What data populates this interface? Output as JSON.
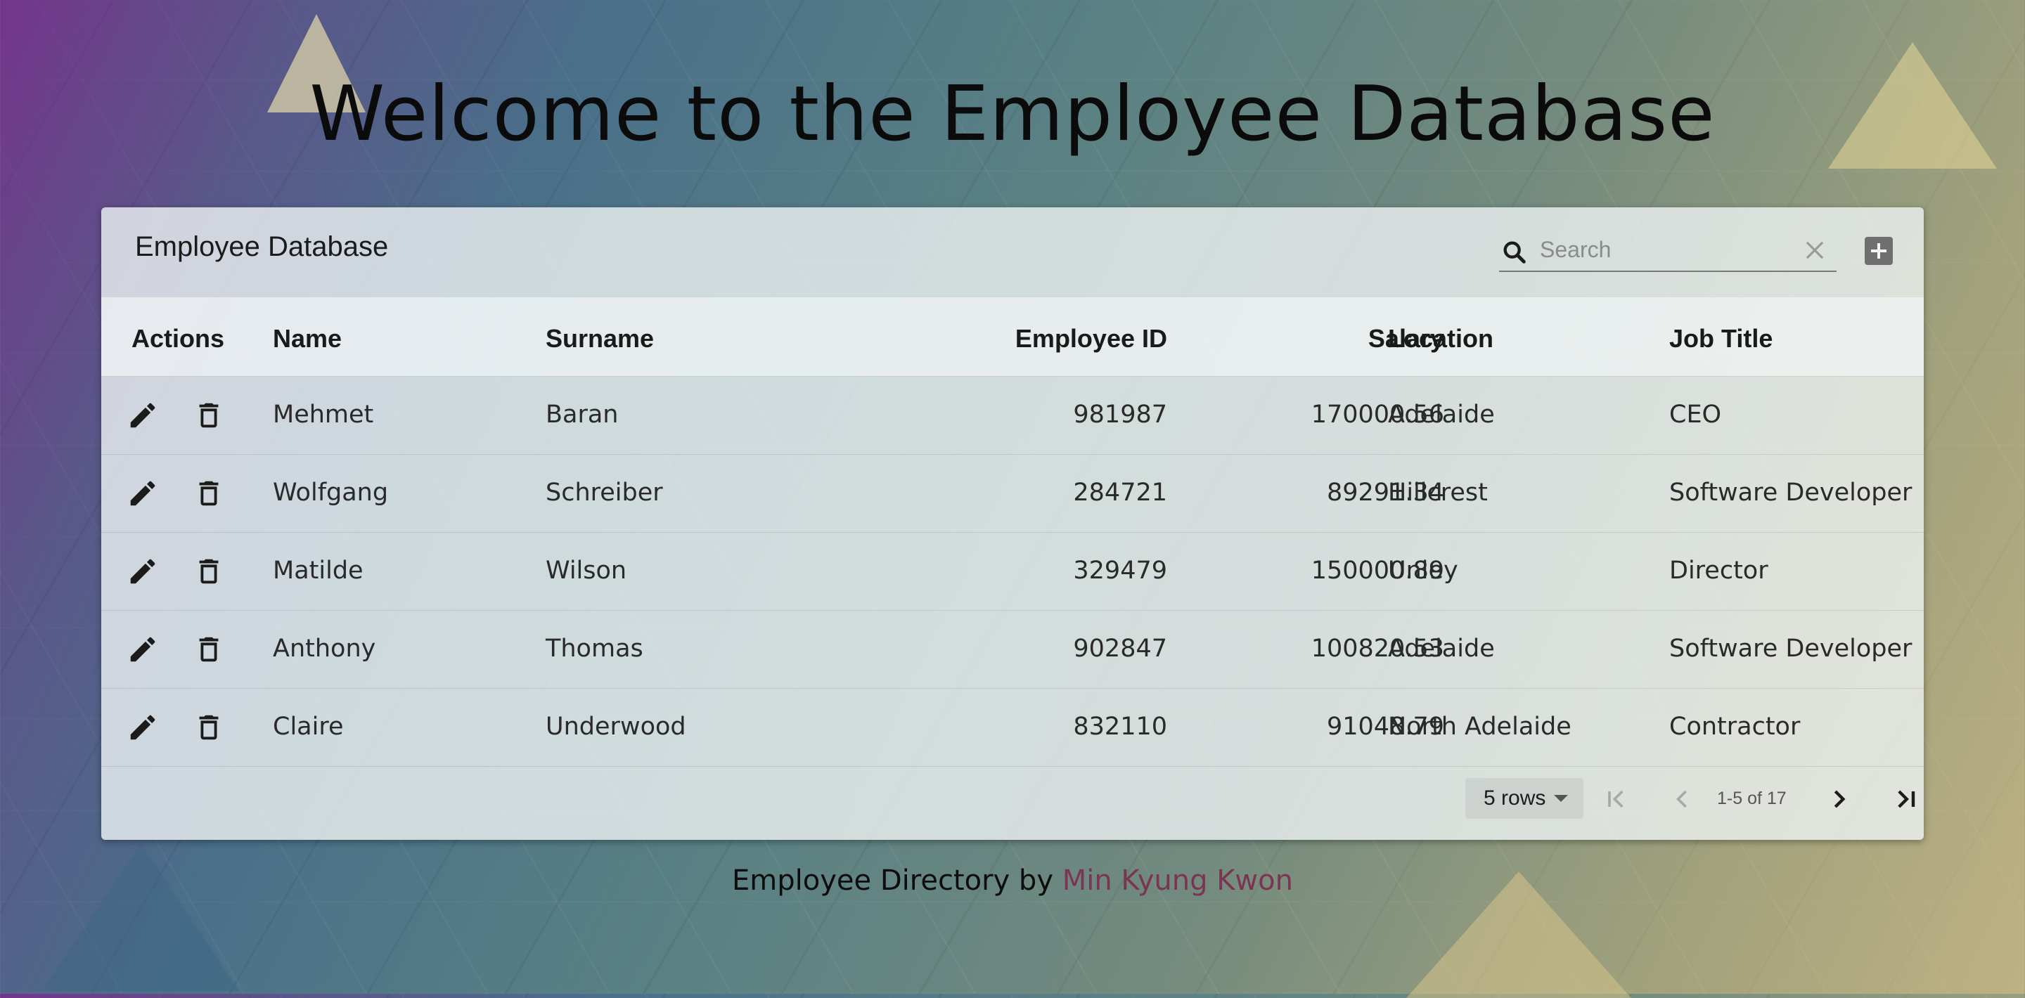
{
  "page": {
    "heading": "Welcome to the Employee Database"
  },
  "toolbar": {
    "title": "Employee Database",
    "search_placeholder": "Search",
    "search_value": ""
  },
  "columns": [
    "Actions",
    "Name",
    "Surname",
    "Employee ID",
    "Salary",
    "Location",
    "Job Title"
  ],
  "rows": [
    {
      "name": "Mehmet",
      "surname": "Baran",
      "employee_id": "981987",
      "salary": "170000.56",
      "location": "Adelaide",
      "job_title": "CEO"
    },
    {
      "name": "Wolfgang",
      "surname": "Schreiber",
      "employee_id": "284721",
      "salary": "89291.34",
      "location": "Hillcrest",
      "job_title": "Software Developer"
    },
    {
      "name": "Matilde",
      "surname": "Wilson",
      "employee_id": "329479",
      "salary": "150000.89",
      "location": "Unley",
      "job_title": "Director"
    },
    {
      "name": "Anthony",
      "surname": "Thomas",
      "employee_id": "902847",
      "salary": "100820.53",
      "location": "Adelaide",
      "job_title": "Software Developer"
    },
    {
      "name": "Claire",
      "surname": "Underwood",
      "employee_id": "832110",
      "salary": "91048.79",
      "location": "North Adelaide",
      "job_title": "Contractor"
    }
  ],
  "pagination": {
    "rows_per_page": "5 rows",
    "range": "1-5 of 17"
  },
  "footer": {
    "prefix": "Employee Directory by ",
    "author": "Min Kyung Kwon"
  },
  "colors": {
    "author_link": "#7b3552",
    "header_bg": "#f5f8fa"
  }
}
